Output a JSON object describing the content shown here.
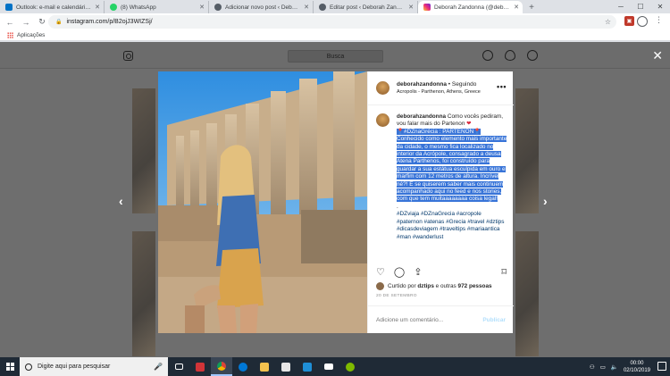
{
  "browser": {
    "tabs": [
      {
        "title": "Outlook: e-mail e calendário pes",
        "color": "#0072c6",
        "active": false
      },
      {
        "title": "(8) WhatsApp",
        "color": "#25d366",
        "active": false
      },
      {
        "title": "Adicionar novo post ‹ Deborah Z",
        "color": "#555d66",
        "active": false
      },
      {
        "title": "Editar post ‹ Deborah Zandonna",
        "color": "#555d66",
        "active": false
      },
      {
        "title": "Deborah Zandonna (@deborahz",
        "color": "#e1306c",
        "active": true
      }
    ],
    "new_tab": "+",
    "url": "instagram.com/p/B2ojJ3WIZSj/",
    "bookmarks_label": "Aplicações"
  },
  "instagram": {
    "search_placeholder": "Busca",
    "post": {
      "username": "deborahzandonna",
      "follow_state": "• Seguindo",
      "location": "Acropolis - Parthenon, Athens, Greece",
      "caption_intro": "Como vocês pediram, vou falar mais do Partenon",
      "caption_heart": "❤",
      "caption_selected": "📍#DZnaGrécia : PARTENON📍 Conhecido como elemento mais importante da cidade, o mesmo fica localizado no interior da Acrópole, consagrado a deusa Atena Parthenos, foi construído para guardar a sua estátua esculpida em ouro e marfim com 12 metros de altura. Incrível né?! E se quiserem saber mais continuem acompanhado aqui no feed e nos stories, com que tem muitaaaaaaaa coisa legal!",
      "caption_dot": ".",
      "hashtags": "#DZviaja #DZnaGrecia #acropole #paternon #atenas #Grecia #travel #dztips #dicasdeviagem #traveltips #mariaantica #man #wanderlust",
      "liked_by_prefix": "Curtido por",
      "liked_by_user": "dztips",
      "liked_by_rest": "e outras",
      "likes_count": "972 pessoas",
      "date": "20 DE SETEMBRO",
      "comment_placeholder": "Adicione um comentário...",
      "publish_label": "Publicar"
    }
  },
  "taskbar": {
    "search_placeholder": "Digite aqui para pesquisar",
    "time": "00:00",
    "date": "02/10/2019",
    "notifications": "3"
  }
}
